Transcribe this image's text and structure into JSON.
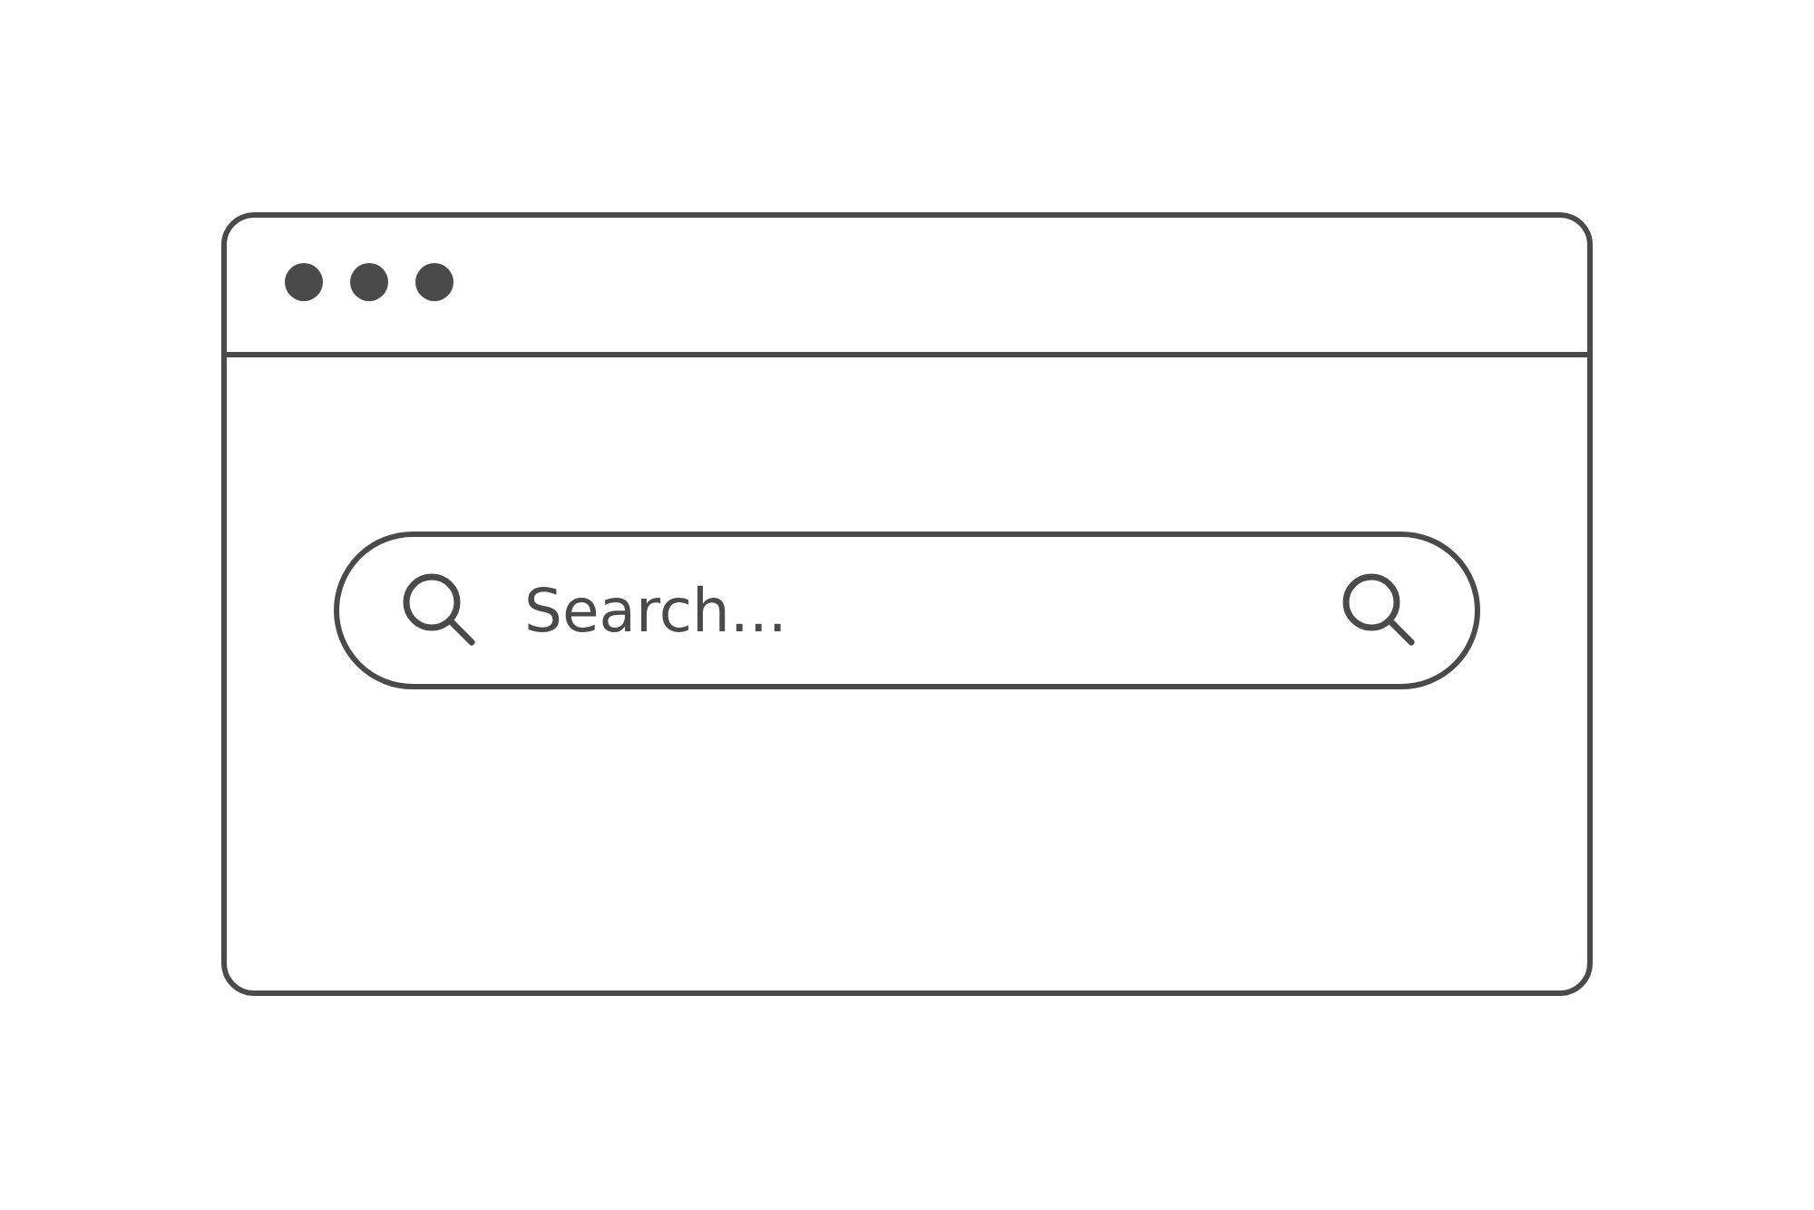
{
  "search": {
    "placeholder": "Search..."
  }
}
